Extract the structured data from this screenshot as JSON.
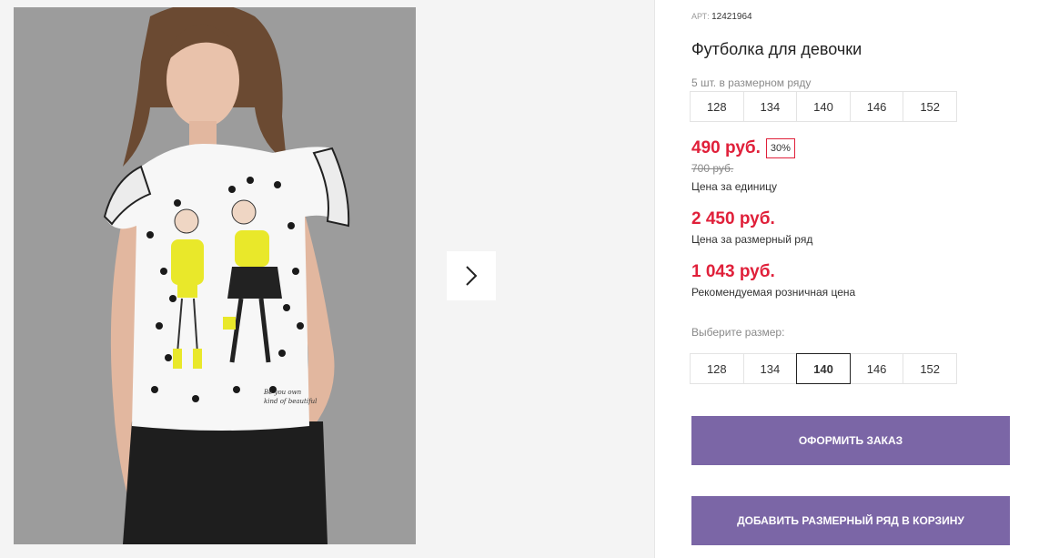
{
  "product": {
    "art_label": "АРТ:",
    "art_value": "12421964",
    "title": "Футболка для девочки",
    "pack_note": "5 шт. в размерном ряду",
    "pack_sizes": [
      "128",
      "134",
      "140",
      "146",
      "152"
    ]
  },
  "prices": {
    "unit_price": "490 руб.",
    "discount": "30%",
    "old_price": "700 руб.",
    "unit_label": "Цена за единицу",
    "pack_price": "2 450 руб.",
    "pack_label": "Цена за размерный ряд",
    "retail_price": "1 043 руб.",
    "retail_label": "Рекомендуемая розничная цена"
  },
  "size_select": {
    "label": "Выберите размер:",
    "options": [
      "128",
      "134",
      "140",
      "146",
      "152"
    ],
    "selected": "140"
  },
  "actions": {
    "order_label": "ОФОРМИТЬ ЗАКАЗ",
    "add_pack_label": "ДОБАВИТЬ РАЗМЕРНЫЙ РЯД В КОРЗИНУ"
  },
  "gallery": {
    "next_icon": "chevron-right-icon"
  },
  "colors": {
    "price_red": "#e0203a",
    "button_purple": "#7b66a6",
    "photo_bg": "#9c9c9c"
  }
}
